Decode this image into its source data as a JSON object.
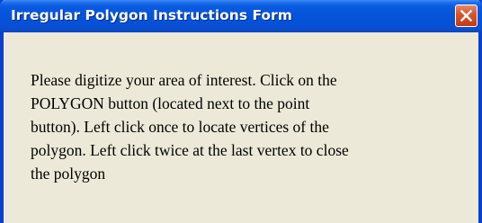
{
  "window": {
    "title": "Irregular Polygon Instructions Form"
  },
  "titlebar": {
    "close_icon": "close-x-icon",
    "colors": {
      "title_bar": "#0554DA",
      "close_button": "#D8562C",
      "window_body": "#ECE9D8"
    }
  },
  "instructions": {
    "lines": [
      "Please digitize your area of interest.  Click on the",
      "POLYGON button (located next to the point",
      "button).  Left click once to locate vertices of the",
      "polygon.  Left click twice at the last vertex to close",
      "the polygon"
    ]
  }
}
